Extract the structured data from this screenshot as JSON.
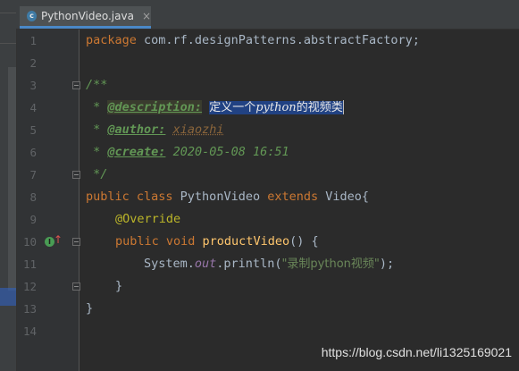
{
  "tab": {
    "label": "PythonVideo.java",
    "close": "×",
    "icon_letter": "c"
  },
  "line_numbers": [
    "1",
    "2",
    "3",
    "4",
    "5",
    "6",
    "7",
    "8",
    "9",
    "10",
    "11",
    "12",
    "13",
    "14"
  ],
  "code": {
    "l1": {
      "kw": "package",
      "rest": " com.rf.designPatterns.abstractFactory;"
    },
    "l3": "/**",
    "l4": {
      "star": " * ",
      "tag": "@description:",
      "text_a": "定义一个",
      "text_b": "python",
      "text_c": "的视频类"
    },
    "l5": {
      "star": " * ",
      "tag": "@author:",
      "value": "xiaozhi"
    },
    "l6": {
      "star": " * ",
      "tag": "@create:",
      "value": "2020-05-08 16:51"
    },
    "l7": " */",
    "l8": {
      "kw1": "public class",
      "name": " PythonVideo ",
      "kw2": "extends",
      "rest": " Video{"
    },
    "l9": "@Override",
    "l10": {
      "kw": "public void",
      "fn": "productVideo",
      "rest": "() {"
    },
    "l11": {
      "a": "System.",
      "out": "out",
      "b": ".println(",
      "str": "\"录制python视频\"",
      "c": ");"
    },
    "l12": "}",
    "l13": "}"
  },
  "gutter_icons": {
    "override_icon_letter": "I",
    "arrow": "↑"
  },
  "watermark": "https://blog.csdn.net/li1325169021"
}
